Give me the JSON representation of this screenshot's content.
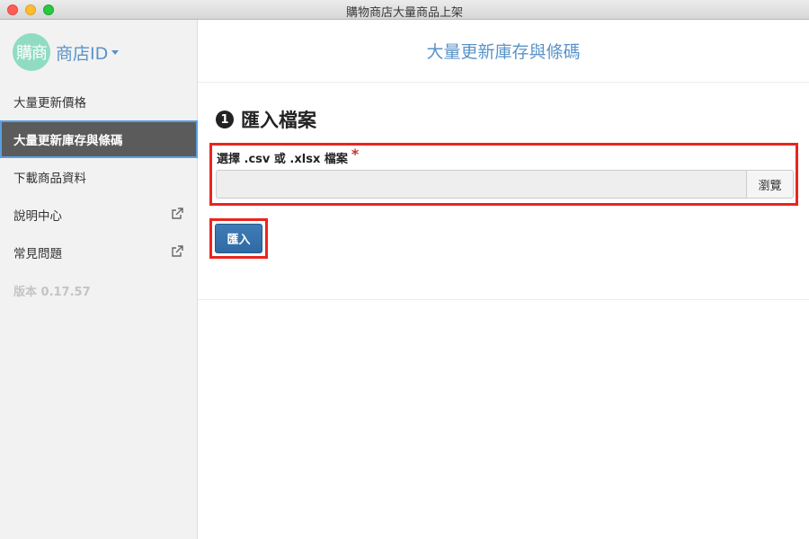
{
  "window": {
    "title": "購物商店大量商品上架"
  },
  "sidebar": {
    "avatar_text": "購商",
    "store_id_label": "商店ID",
    "items": [
      {
        "label": "大量更新價格",
        "active": false,
        "external": false
      },
      {
        "label": "大量更新庫存與條碼",
        "active": true,
        "external": false
      },
      {
        "label": "下載商品資料",
        "active": false,
        "external": false
      },
      {
        "label": "說明中心",
        "active": false,
        "external": true
      },
      {
        "label": "常見問題",
        "active": false,
        "external": true
      }
    ],
    "version": "版本 0.17.57"
  },
  "main": {
    "page_title": "大量更新庫存與條碼",
    "step_number": "1",
    "step_title": "匯入檔案",
    "file_label": "選擇 .csv 或 .xlsx 檔案",
    "required_mark": "*",
    "file_value": "",
    "browse_label": "瀏覽",
    "import_label": "匯入"
  },
  "colors": {
    "accent": "#5a93c8",
    "active_nav": "#5b5b5b",
    "primary_button": "#2f6aa3",
    "highlight_border": "#e8261f",
    "avatar": "#8fdcc2"
  },
  "icons": {
    "external": "external-link-icon",
    "caret": "chevron-down-icon"
  }
}
